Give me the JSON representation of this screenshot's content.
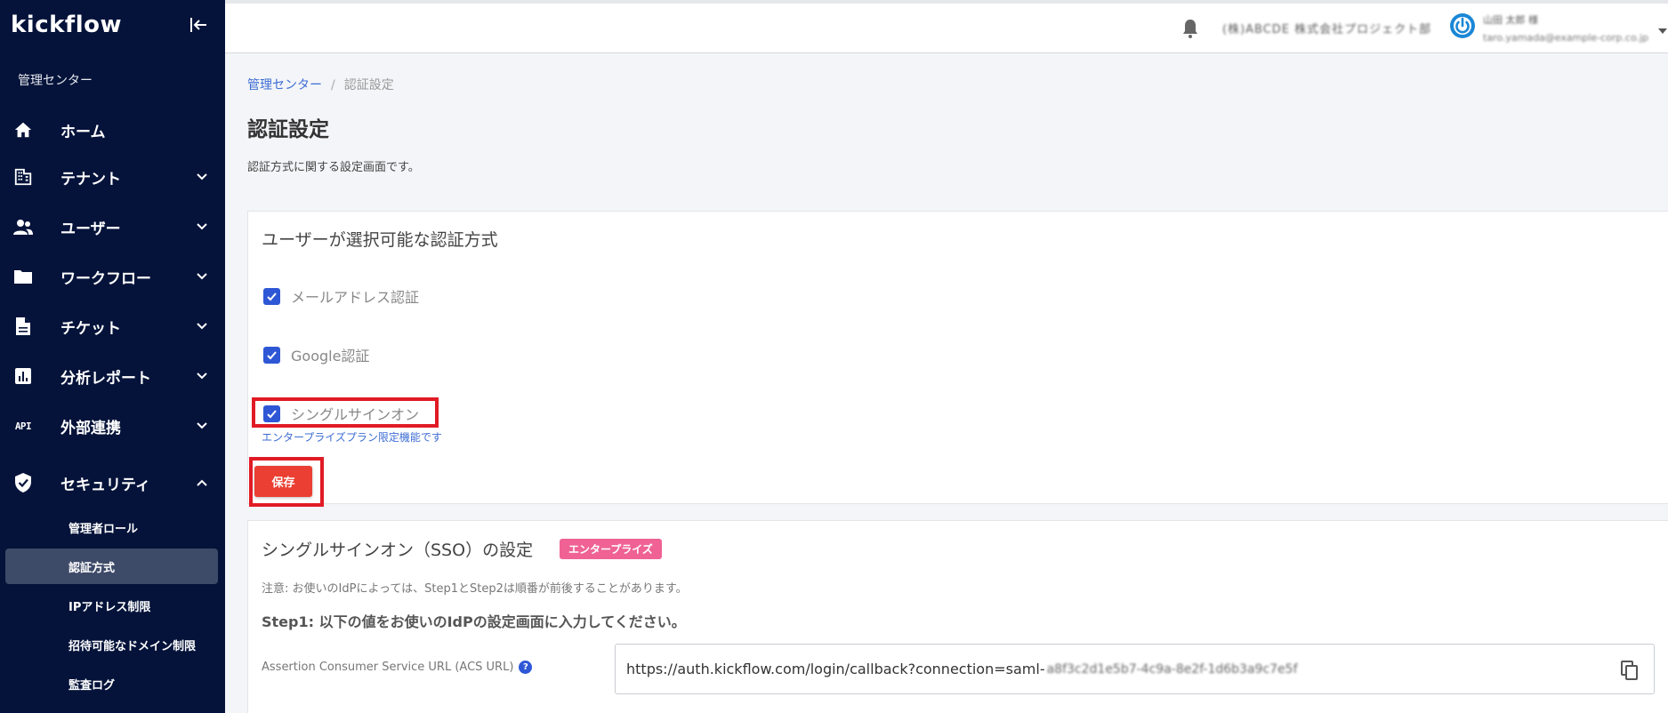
{
  "sidebar": {
    "logo": "kickflow",
    "section_label": "管理センター",
    "items": [
      {
        "label": "ホーム",
        "icon": "home-icon"
      },
      {
        "label": "テナント",
        "icon": "building-icon"
      },
      {
        "label": "ユーザー",
        "icon": "users-icon"
      },
      {
        "label": "ワークフロー",
        "icon": "folder-icon"
      },
      {
        "label": "チケット",
        "icon": "document-icon"
      },
      {
        "label": "分析レポート",
        "icon": "report-icon"
      },
      {
        "label": "外部連携",
        "icon": "api-icon",
        "icon_text": "API"
      },
      {
        "label": "セキュリティ",
        "icon": "shield-icon"
      }
    ],
    "security_sub": [
      "管理者ロール",
      "認証方式",
      "IPアドレス制限",
      "招待可能なドメイン制限",
      "監査ログ"
    ],
    "active_sub": "認証方式"
  },
  "header": {
    "tenant_name": "(株)ABCDE 株式会社プロジェクト部",
    "user_name": "山田 太郎 様",
    "user_email": "taro.yamada@example-corp.co.jp"
  },
  "main": {
    "breadcrumb": {
      "parent": "管理センター",
      "separator": "/",
      "current": "認証設定"
    },
    "title": "認証設定",
    "description": "認証方式に関する設定画面です。",
    "auth_card": {
      "title": "ユーザーが選択可能な認証方式",
      "options": [
        {
          "label": "メールアドレス認証",
          "checked": true
        },
        {
          "label": "Google認証",
          "checked": true
        },
        {
          "label": "シングルサインオン",
          "checked": true
        }
      ],
      "enterprise_note": "エンタープライズプラン限定機能です",
      "save_label": "保存"
    },
    "sso_card": {
      "title": "シングルサインオン（SSO）の設定",
      "badge": "エンタープライズ",
      "caution": "注意: お使いのIdPによっては、Step1とStep2は順番が前後することがあります。",
      "step1": "Step1: 以下の値をお使いのIdPの設定画面に入力してください。",
      "acs_label": "Assertion Consumer Service URL (ACS URL)",
      "acs_value": "https://auth.kickflow.com/login/callback?connection=saml-",
      "acs_value_hidden": "a8f3c2d1e5b7-4c9a-8e2f-1d6b3a9c7e5f"
    }
  },
  "colors": {
    "sidebar_bg": "#05133a",
    "accent": "#2e57d6",
    "save_button": "#ea3f32",
    "highlight": "#e11b25",
    "badge": "#ef6293",
    "link": "#3d6dd3"
  }
}
